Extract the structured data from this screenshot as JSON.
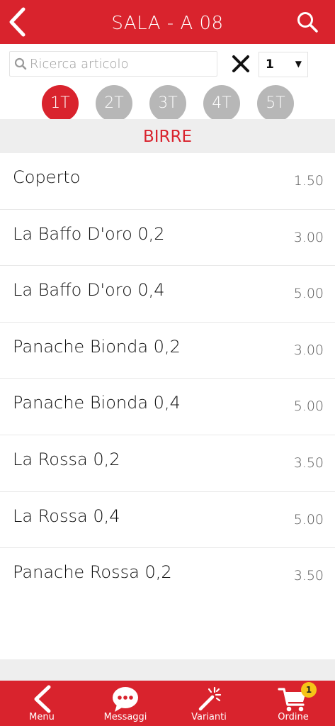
{
  "header": {
    "title": "SALA - A 08",
    "back_icon": "chevron-left-icon",
    "search_icon": "search-icon"
  },
  "search": {
    "placeholder": "Ricerca articolo",
    "value": "",
    "quantity": "1"
  },
  "turns": [
    {
      "label": "1T",
      "active": true
    },
    {
      "label": "2T",
      "active": false
    },
    {
      "label": "3T",
      "active": false
    },
    {
      "label": "4T",
      "active": false
    },
    {
      "label": "5T",
      "active": false
    }
  ],
  "category": "BIRRE",
  "items": [
    {
      "name": "Coperto",
      "price": "1.50"
    },
    {
      "name": "La Baffo D'oro 0,2",
      "price": "3.00"
    },
    {
      "name": "La Baffo D'oro 0,4",
      "price": "5.00"
    },
    {
      "name": "Panache Bionda 0,2",
      "price": "3.00"
    },
    {
      "name": "Panache Bionda 0,4",
      "price": "5.00"
    },
    {
      "name": "La Rossa 0,2",
      "price": "3.50"
    },
    {
      "name": "La Rossa 0,4",
      "price": "5.00"
    },
    {
      "name": "Panache Rossa 0,2",
      "price": "3.50"
    }
  ],
  "bottom_nav": {
    "menu": "Menu",
    "messages": "Messaggi",
    "variants": "Varianti",
    "order": "Ordine",
    "order_badge": "1"
  },
  "colors": {
    "brand_red": "#d9232d",
    "turn_inactive": "#b7b7b7",
    "badge_yellow": "#f5c518"
  }
}
